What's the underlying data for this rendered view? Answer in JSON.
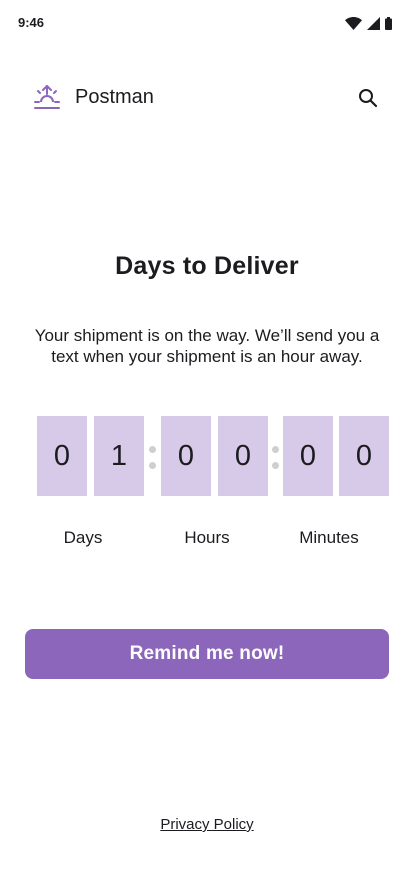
{
  "status_bar": {
    "time": "9:46",
    "icons": [
      "wifi-icon",
      "cell-signal-icon",
      "battery-icon"
    ]
  },
  "app_bar": {
    "title": "Postman",
    "logo_icon": "sunrise-logo-icon",
    "search_icon": "search-icon"
  },
  "main": {
    "headline": "Days to Deliver",
    "message": "Your shipment is on the way. We’ll send you a text when your shipment is an hour away.",
    "countdown": {
      "digits": [
        "0",
        "1",
        "0",
        "0",
        "0",
        "0"
      ],
      "labels": {
        "days": "Days",
        "hours": "Hours",
        "minutes": "Minutes"
      }
    },
    "remind_button": "Remind me now!"
  },
  "footer": {
    "privacy_link": "Privacy Policy"
  },
  "colors": {
    "accent": "#8c66bb",
    "digit_bg": "#d7cae8",
    "text": "#1c1b1f"
  }
}
